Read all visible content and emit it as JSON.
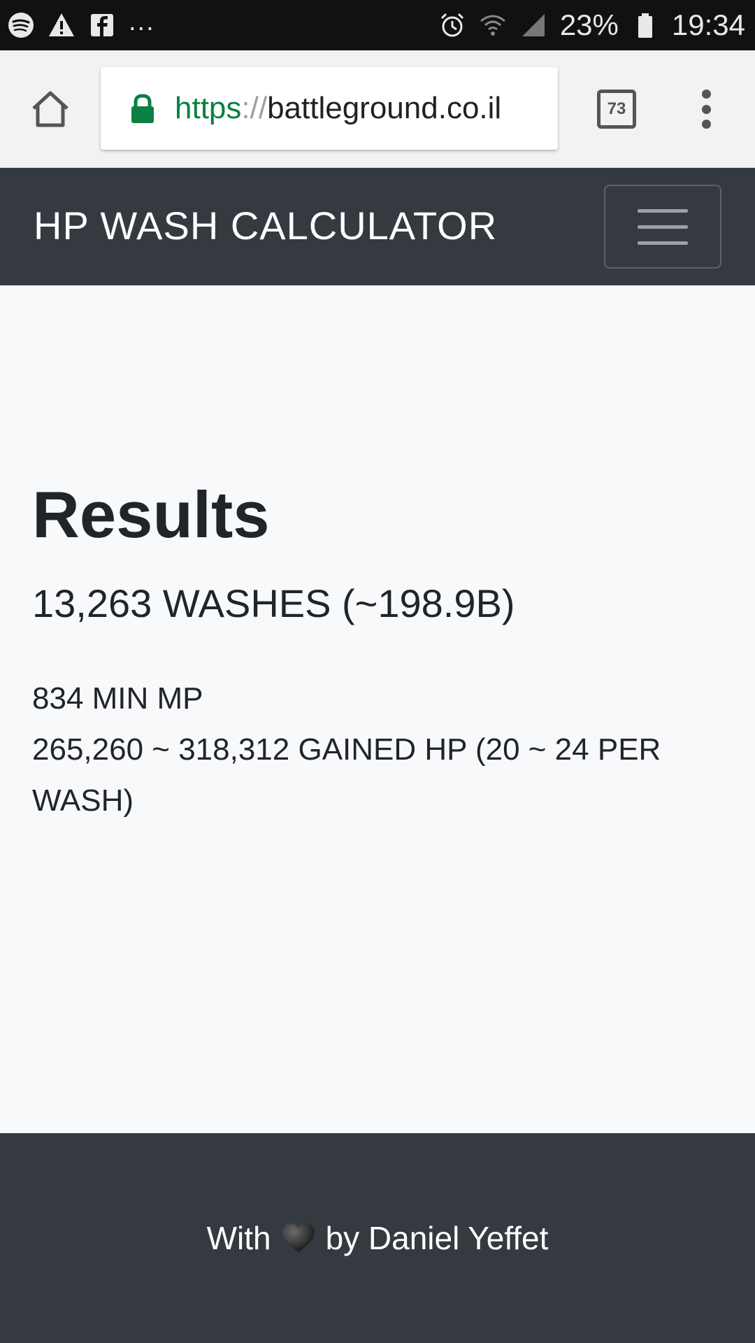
{
  "status_bar": {
    "left_icons": [
      "spotify-icon",
      "warning-icon",
      "facebook-icon"
    ],
    "more_indicator": "...",
    "right_icons": [
      "alarm-icon",
      "wifi-icon",
      "signal-icon",
      "battery-icon"
    ],
    "battery_percent": "23%",
    "time": "19:34"
  },
  "browser": {
    "url_scheme": "https",
    "url_separator": "://",
    "url_host": "battleground.co.il",
    "tab_count": "73",
    "icons": [
      "home-icon",
      "lock-icon",
      "tab-switcher-icon",
      "overflow-menu-icon"
    ]
  },
  "navbar": {
    "brand": "HP WASH CALCULATOR",
    "toggler_icon": "hamburger-icon"
  },
  "results": {
    "title": "Results",
    "summary": "13,263 WASHES (~198.9B)",
    "min_mp": "834 MIN MP",
    "gained_hp": "265,260 ~ 318,312 GAINED HP (20 ~ 24 PER WASH)"
  },
  "footer": {
    "text_before": "With",
    "icon": "heart-icon",
    "text_after": "by Daniel Yeffet"
  },
  "colors": {
    "navbar_bg": "#343a40",
    "page_bg": "#f8f9fa",
    "secure_green": "#0b8043",
    "text_dark": "#212529"
  }
}
